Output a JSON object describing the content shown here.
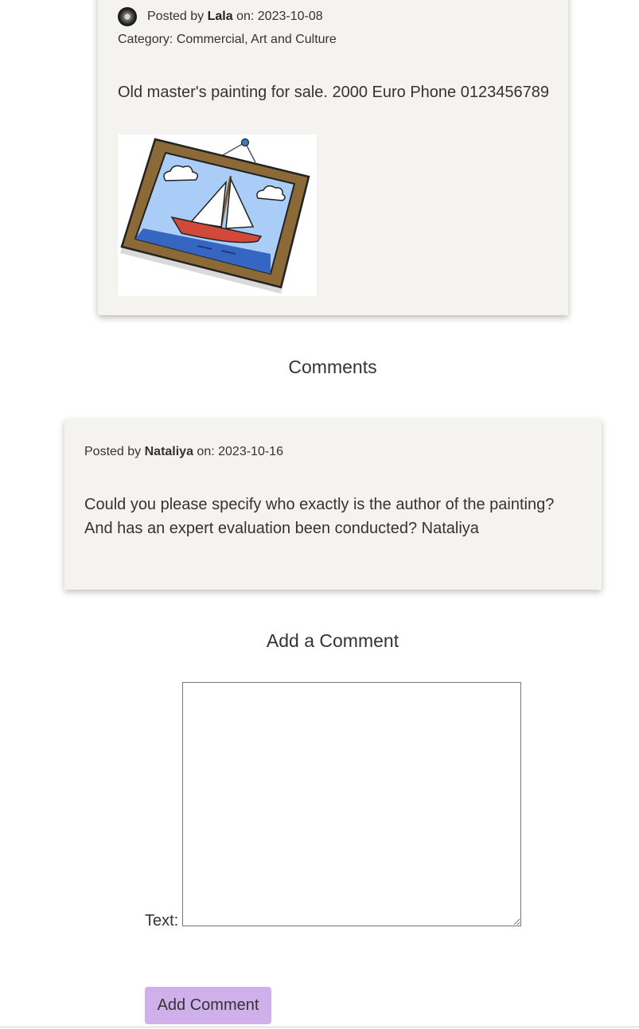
{
  "post": {
    "posted_by_prefix": "Posted by ",
    "author": "Lala",
    "on_label": " on: ",
    "date": "2023-10-08",
    "category_label": "Category: ",
    "categories": "Commercial, Art and Culture",
    "body": "Old master's painting for sale. 2000 Euro Phone 0123456789",
    "image_alt": "Framed painting of a sailboat"
  },
  "comments_section": {
    "title": "Comments",
    "items": [
      {
        "posted_by_prefix": "Posted by ",
        "author": "Nataliya",
        "on_label": " on: ",
        "date": "2023-10-16",
        "body": "Could you please specify who exactly is the author of the painting? And has an expert evaluation been conducted? Nataliya"
      }
    ]
  },
  "add_comment": {
    "title": "Add a Comment",
    "text_label": "Text:",
    "textarea_value": "",
    "submit_label": "Add Comment"
  },
  "colors": {
    "card_background": "#f4f3f0",
    "button_background": "#cfb0ea"
  }
}
